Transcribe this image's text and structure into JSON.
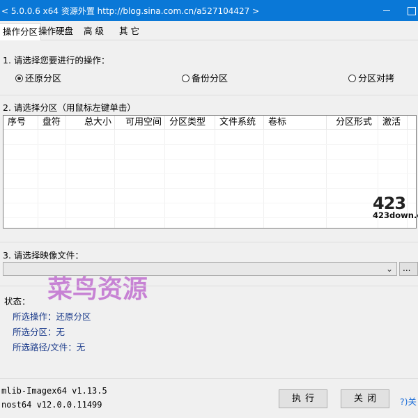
{
  "window": {
    "title": "< 5.0.0.6 x64 资源外置 http://blog.sina.com.cn/a527104427 >"
  },
  "tabs": [
    {
      "label": "操作分区",
      "active": true
    },
    {
      "label": "操作硬盘",
      "active": false
    },
    {
      "label": "高 级",
      "active": false
    },
    {
      "label": "其 它",
      "active": false
    }
  ],
  "step1": {
    "label": "1. 请选择您要进行的操作：",
    "options": [
      {
        "label": "还原分区",
        "checked": true
      },
      {
        "label": "备份分区",
        "checked": false
      },
      {
        "label": "分区对拷",
        "checked": false
      }
    ]
  },
  "step2": {
    "label": "2. 请选择分区（用鼠标左键单击）",
    "columns": [
      "序号",
      "盘符",
      "总大小",
      "可用空间",
      "分区类型",
      "文件系统",
      "卷标",
      "分区形式",
      "激活"
    ],
    "rows": []
  },
  "step3": {
    "label": "3. 请选择映像文件：",
    "image_file": "",
    "browse_label": "..."
  },
  "watermark": "菜鸟资源",
  "logo": {
    "big": "423",
    "small": "423down.c"
  },
  "status": {
    "title": "状态：",
    "operation": "所选操作：还原分区",
    "partition": "所选分区：无",
    "path": "所选路径/文件：无"
  },
  "versions": {
    "line1": "mlib-Imagex64 v1.13.5",
    "line2": "nost64 v12.0.0.11499"
  },
  "buttons": {
    "execute": "执行",
    "close": "关闭",
    "help": "?)关"
  },
  "colors": {
    "titlebar": "#0a78d7",
    "watermark": "#c06fd0",
    "status_text": "#1a3a8a",
    "help_link": "#1e6fd9"
  }
}
